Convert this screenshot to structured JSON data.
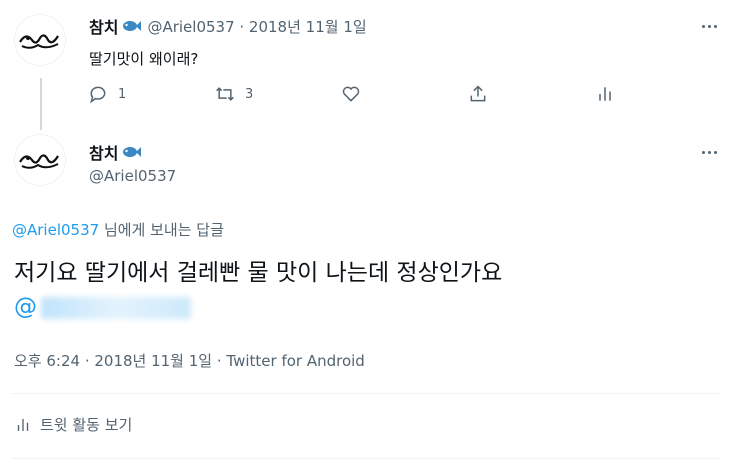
{
  "tweet1": {
    "name": "참치",
    "handle_date": "@Ariel0537 · 2018년 11월 1일",
    "text": "딸기맛이 왜이래?",
    "reply_count": "1",
    "retweet_count": "3"
  },
  "tweet2": {
    "name": "참치",
    "handle": "@Ariel0537",
    "reply_to_handle": "@Ariel0537",
    "reply_to_suffix": " 님에게 보내는 답글",
    "text": "저기요 딸기에서 걸레빤 물 맛이 나는데 정상인가요",
    "mention_prefix": "@",
    "timestamp": "오후 6:24 · 2018년 11월 1일 · Twitter for Android"
  },
  "activity_label": "트윗 활동 보기",
  "colors": {
    "link": "#1d9bf0",
    "secondary": "#536471",
    "text": "#0f1419"
  },
  "icons": [
    "avatar-logo-icon",
    "fish-emoji-icon",
    "more-icon",
    "reply-icon",
    "retweet-icon",
    "like-icon",
    "share-icon",
    "analytics-icon"
  ]
}
